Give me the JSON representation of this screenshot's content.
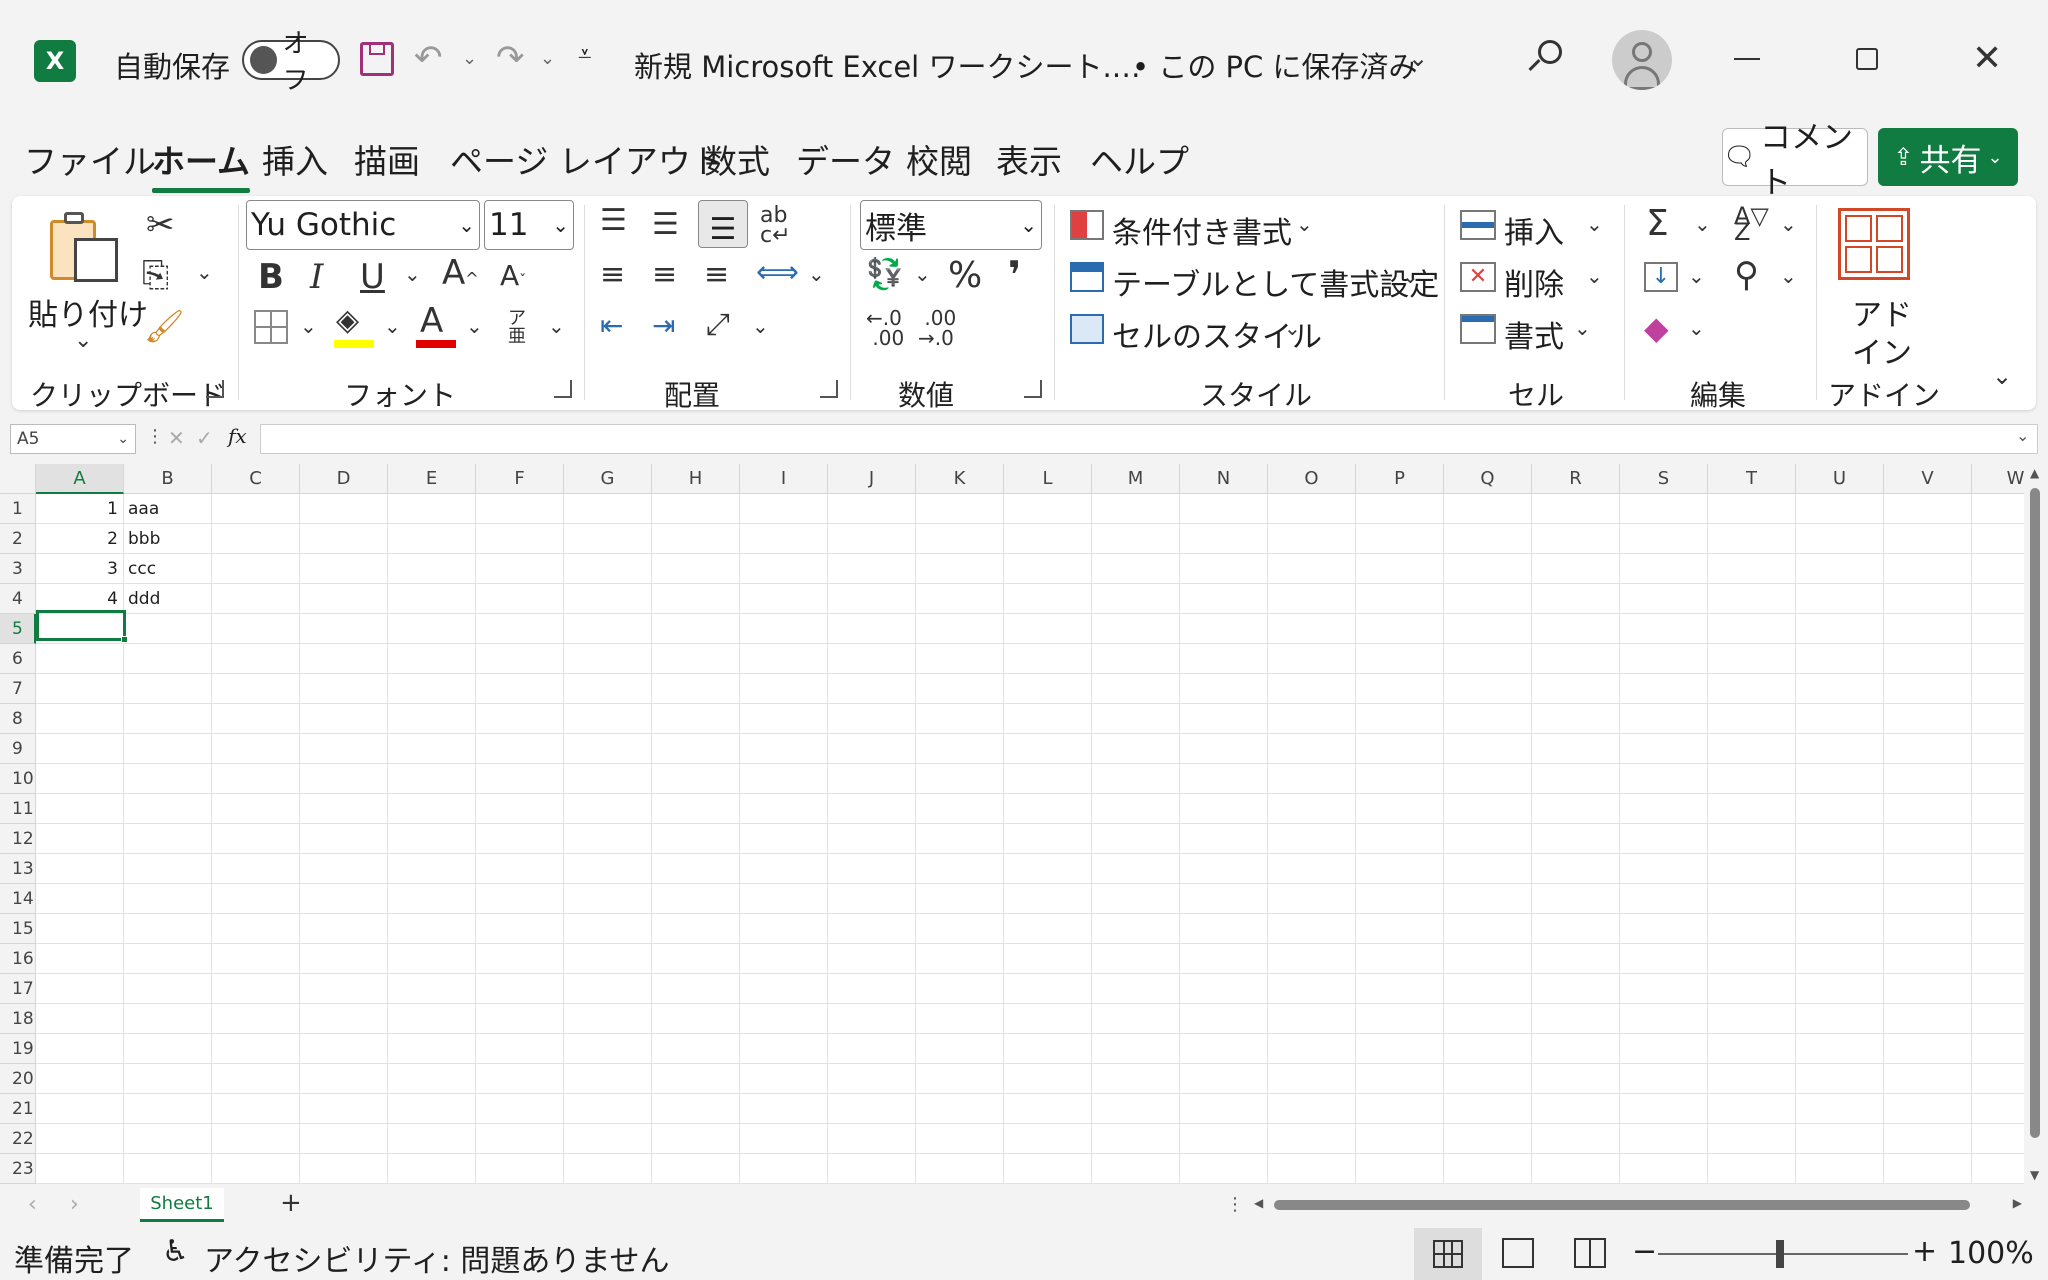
{
  "titlebar": {
    "autosave_label": "自動保存",
    "autosave_state": "オフ",
    "document_title": "新規 Microsoft Excel ワークシート.…",
    "save_status": "• この PC に保存済み"
  },
  "tabs": [
    "ファイル",
    "ホーム",
    "挿入",
    "描画",
    "ページ レイアウト",
    "数式",
    "データ",
    "校閲",
    "表示",
    "ヘルプ"
  ],
  "active_tab": "ホーム",
  "actions": {
    "comment": "コメント",
    "share": "共有"
  },
  "ribbon": {
    "clipboard": {
      "label": "クリップボード",
      "paste": "貼り付け"
    },
    "font": {
      "label": "フォント",
      "name": "Yu Gothic",
      "size": "11",
      "phonetic": "ア亜"
    },
    "alignment": {
      "label": "配置"
    },
    "number": {
      "label": "数値",
      "format": "標準"
    },
    "styles": {
      "label": "スタイル",
      "conditional": "条件付き書式",
      "table": "テーブルとして書式設定",
      "cell_styles": "セルのスタイル"
    },
    "cells": {
      "label": "セル",
      "insert": "挿入",
      "delete": "削除",
      "format": "書式"
    },
    "editing": {
      "label": "編集"
    },
    "addins": {
      "label": "アドイン",
      "button_line1": "アド",
      "button_line2": "イン"
    }
  },
  "formula_bar": {
    "name_box": "A5",
    "formula": ""
  },
  "columns": [
    "A",
    "B",
    "C",
    "D",
    "E",
    "F",
    "G",
    "H",
    "I",
    "J",
    "K",
    "L",
    "M",
    "N",
    "O",
    "P",
    "Q",
    "R",
    "S",
    "T",
    "U",
    "V",
    "W"
  ],
  "rows": [
    "1",
    "2",
    "3",
    "4",
    "5",
    "6",
    "7",
    "8",
    "9",
    "10",
    "11",
    "12",
    "13",
    "14",
    "15",
    "16",
    "17",
    "18",
    "19",
    "20",
    "21",
    "22",
    "23"
  ],
  "cells": [
    {
      "a": "1",
      "b": "aaa"
    },
    {
      "a": "2",
      "b": "bbb"
    },
    {
      "a": "3",
      "b": "ccc"
    },
    {
      "a": "4",
      "b": "ddd"
    }
  ],
  "sheet": {
    "name": "Sheet1"
  },
  "status": {
    "ready": "準備完了",
    "accessibility": "アクセシビリティ: 問題ありません",
    "zoom": "100%"
  },
  "colors": {
    "accent": "#107c41",
    "highlight": "#ffff00",
    "font_color": "#e00000"
  }
}
